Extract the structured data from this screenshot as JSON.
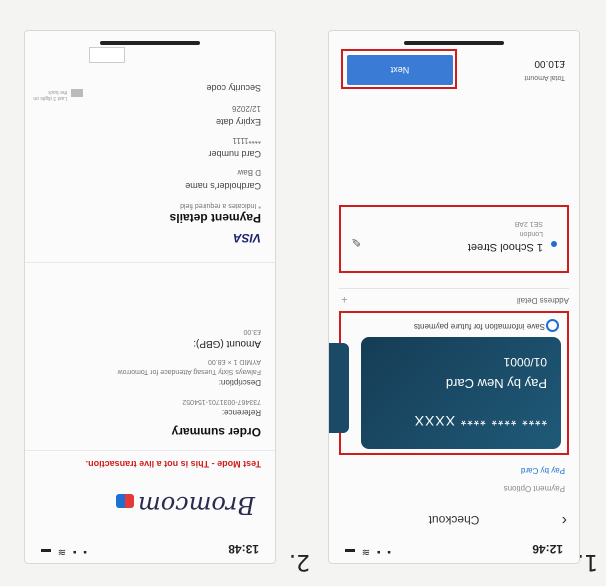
{
  "steps": [
    "1.",
    "2."
  ],
  "phone1": {
    "status_time": "12:46",
    "status_icons": "▪ ▪ ≋ ▬",
    "nav_back": "‹",
    "nav_title": "Checkout",
    "payment_options_label": "Payment Options",
    "pay_by_card_tab": "Pay by Card",
    "card": {
      "number": "**** **** **** XXXX",
      "name": "Pay by New Card",
      "expiry": "01/0001"
    },
    "save_info_label": "Save information for future payments",
    "address_details_label": "Address Detail",
    "address": {
      "line1": "1 School Street",
      "line2": "London",
      "line3": "SE1 2AB"
    },
    "total_amount_label": "Total Amount",
    "total_amount_value": "£10.00",
    "next_button": "Next"
  },
  "phone2": {
    "status_time": "13:48",
    "status_icons": "▪ ▪ ≋ ▬",
    "logo": "Bromcom",
    "test_mode": "Test Mode - This is not a live transaction.",
    "order_summary_title": "Order summary",
    "reference_label": "Reference:",
    "reference_value": "733467-0031701-154052",
    "description_label": "Description:",
    "description_value": "Falways Sixty Tuesag Attendace for Tomorrow",
    "description_value2": "AYMID 1 × £8.00",
    "amount_label": "Amount (GBP):",
    "amount_value": "£3.00",
    "card_brand": "VISA",
    "payment_details_title": "Payment details",
    "required_note": "* Indicates a required field",
    "cardholder_label": "Cardholder's name",
    "cardholder_value": "D Baw",
    "card_number_label": "Card number",
    "card_number_value": "****1111",
    "expiry_label": "Expiry date",
    "expiry_value": "12/2026",
    "security_label": "Security code",
    "security_hint": "Last 3 digits on the back"
  }
}
